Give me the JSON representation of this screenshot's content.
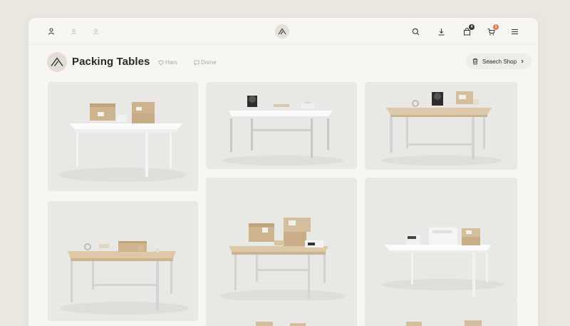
{
  "colors": {
    "background": "#ebe6df",
    "panel": "#f7f6f3",
    "card": "#e9e8e5",
    "accent_badge": "#e07b5a",
    "dark_badge": "#333333",
    "wood": "#dcc9a8",
    "kraft_box": "#cdb48f"
  },
  "topbar": {
    "left_icons": [
      "user-icon",
      "user-outline-icon",
      "user-outline-icon"
    ],
    "right_icons": [
      "search-icon",
      "download-icon",
      "bag-icon",
      "cart-icon",
      "menu-icon"
    ],
    "bag_badge": "4",
    "cart_badge": "1"
  },
  "header": {
    "title": "Packing Tables",
    "chip_1": "Hars",
    "chip_2": "Dorne",
    "search_shop": "Seaech Shop"
  },
  "products": [
    {
      "table": "white",
      "items": "kraft boxes, label printer"
    },
    {
      "table": "white",
      "items": "tape dispenser, tray, scale"
    },
    {
      "table": "wood",
      "items": "tape, tape dispenser, kraft box"
    },
    {
      "table": "wood",
      "items": "kraft boxes, scale"
    },
    {
      "table": "wood",
      "items": "tape roll, kraft box, small boxes"
    },
    {
      "table": "white",
      "items": "scale, white box, kraft boxes"
    },
    {
      "table": "wood",
      "items": "kraft boxes"
    },
    {
      "table": "wood",
      "items": "kraft boxes"
    }
  ]
}
